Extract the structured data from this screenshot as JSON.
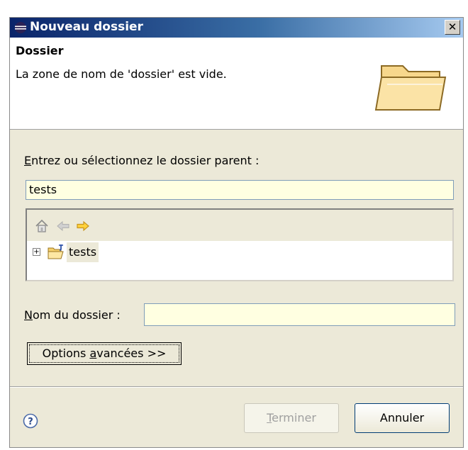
{
  "window": {
    "title": "Nouveau dossier",
    "close_glyph": "✕",
    "icon": "eclipse-icon"
  },
  "header": {
    "title": "Dossier",
    "message": "La zone de nom de 'dossier' est vide.",
    "icon": "folder-open-icon"
  },
  "parent": {
    "label_accel": "E",
    "label_rest": "ntrez ou sélectionnez le dossier parent :",
    "value": "tests"
  },
  "tree": {
    "toolbar_icons": [
      "home-icon",
      "back-arrow-icon",
      "forward-arrow-icon"
    ],
    "items": [
      {
        "label": "tests",
        "expanded": false,
        "selected": true
      }
    ]
  },
  "folder_name": {
    "label_accel": "N",
    "label_rest": "om du dossier :",
    "value": ""
  },
  "advanced_button": {
    "label_pre": "Options ",
    "label_accel": "a",
    "label_post": "vancées >>"
  },
  "buttons": {
    "finish_accel": "T",
    "finish_rest": "erminer",
    "finish_enabled": false,
    "cancel": "Annuler"
  },
  "colors": {
    "titlebar_start": "#0a246a",
    "titlebar_end": "#a6caf0",
    "dialog_bg": "#ece9d8",
    "field_bg": "#ffffe1"
  }
}
